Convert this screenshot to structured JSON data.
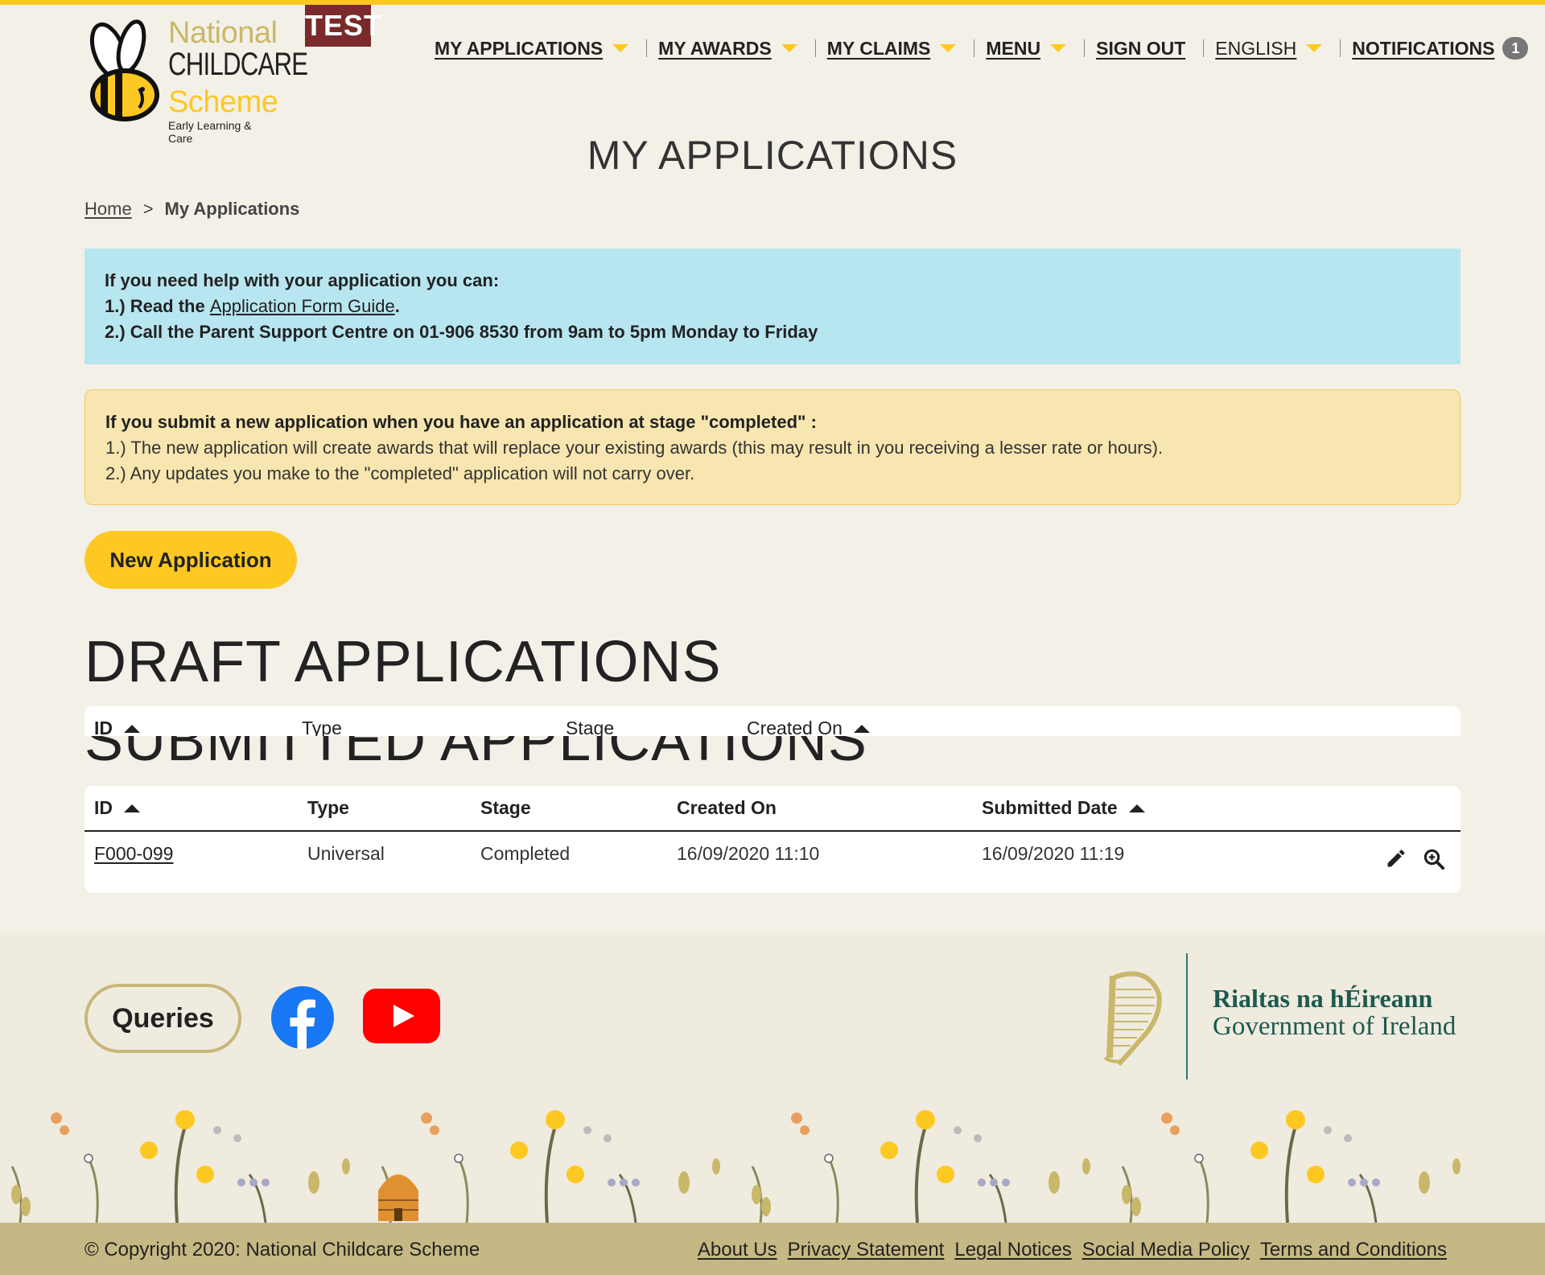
{
  "brand": {
    "line1": "National",
    "line2": "CHILDCARE",
    "line3": "Scheme",
    "line4": "Early Learning & Care",
    "env_badge": "TEST"
  },
  "nav": {
    "items": [
      {
        "label": "MY APPLICATIONS"
      },
      {
        "label": "MY AWARDS"
      },
      {
        "label": "MY CLAIMS"
      },
      {
        "label": "MENU"
      },
      {
        "label": "SIGN OUT"
      },
      {
        "label": "ENGLISH"
      },
      {
        "label": "NOTIFICATIONS"
      }
    ],
    "notification_count": "1"
  },
  "page_title": "MY APPLICATIONS",
  "breadcrumb": {
    "home": "Home",
    "separator": ">",
    "current": "My Applications"
  },
  "help_box": {
    "heading": "If you need help with your application you can:",
    "line1_prefix": "1.)  Read the ",
    "line1_link": "Application Form Guide",
    "line1_suffix": ".",
    "line2": "2.)  Call the Parent Support Centre on  01-906 8530 from 9am to 5pm Monday to Friday"
  },
  "warning_box": {
    "heading": "If you submit a new application when you have an application at stage \"completed\" :",
    "line1": "1.) The new application will create awards that will replace your existing awards (this may result in you receiving a lesser rate or hours).",
    "line2": "2.) Any updates you make to the \"completed\" application will not carry over."
  },
  "new_application_label": "New Application",
  "draft": {
    "heading": "DRAFT APPLICATIONS",
    "columns": [
      "ID",
      "Type",
      "Stage",
      "Created On"
    ]
  },
  "submitted": {
    "heading": "SUBMITTED APPLICATIONS",
    "columns": [
      "ID",
      "Type",
      "Stage",
      "Created On",
      "Submitted Date"
    ],
    "rows": [
      {
        "id": "F000-099",
        "type": "Universal",
        "stage": "Completed",
        "created_on": "16/09/2020 11:10",
        "submitted_date": "16/09/2020 11:19"
      }
    ]
  },
  "footer": {
    "queries_label": "Queries",
    "gov_irish": "Rialtas na hÉireann",
    "gov_english": "Government of Ireland",
    "copyright": "© Copyright 2020: National Childcare Scheme",
    "links": [
      "About Us",
      "Privacy Statement",
      "Legal Notices",
      "Social Media Policy",
      "Terms and Conditions"
    ]
  },
  "colors": {
    "accent_yellow": "#fdc822",
    "info_blue": "#b8e6f0",
    "warning_yellow": "#f8e6b0",
    "footer_bar": "#c6b884",
    "gov_green": "#1b5a4f",
    "test_badge": "#7a2a2a"
  }
}
